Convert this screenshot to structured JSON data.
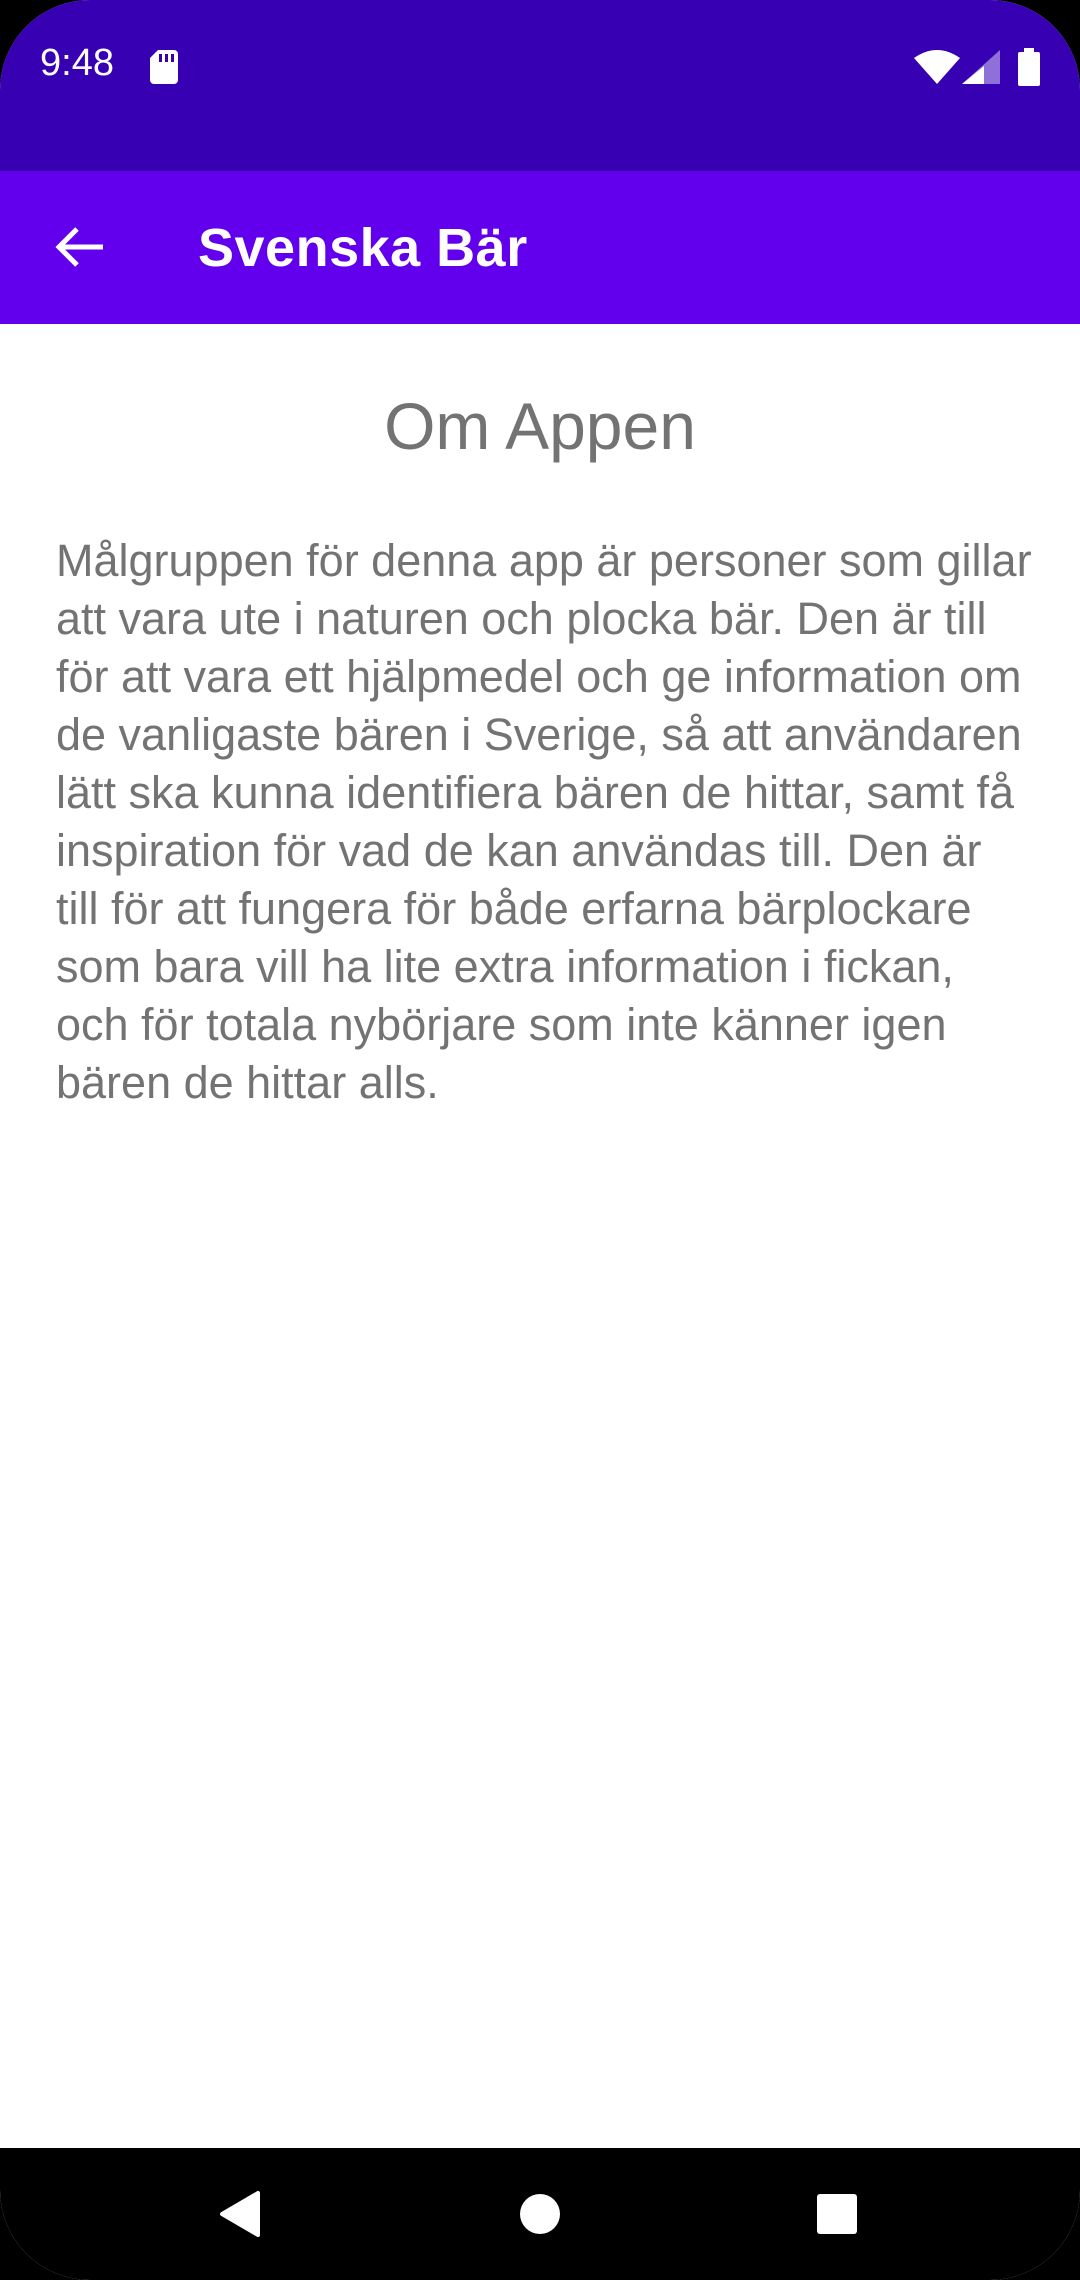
{
  "status_bar": {
    "time": "9:48",
    "icons": [
      "sd-card-icon",
      "wifi-icon",
      "signal-icon",
      "battery-icon"
    ]
  },
  "app_bar": {
    "back_icon": "arrow-left-icon",
    "title": "Svenska Bär"
  },
  "content": {
    "heading": "Om Appen",
    "paragraph": "Målgruppen för denna app är personer som gillar att vara ute i naturen och plocka bär. Den är till för att vara ett hjälpmedel och ge information om de vanligaste bären i Sverige, så att användaren lätt ska kunna identifiera bären de hittar, samt få inspiration för vad de kan användas till. Den är till för att fungera för både erfarna bärplockare som bara vill ha lite extra information i fickan, och för totala nybörjare som inte känner igen bären de hittar alls."
  },
  "navigation_bar": {
    "buttons": [
      "back-triangle-icon",
      "home-circle-icon",
      "recents-square-icon"
    ]
  },
  "colors": {
    "status_bar": "#3700b3",
    "app_bar": "#6200ee",
    "text": "#737373",
    "background": "#ffffff",
    "nav_bar": "#000000"
  }
}
